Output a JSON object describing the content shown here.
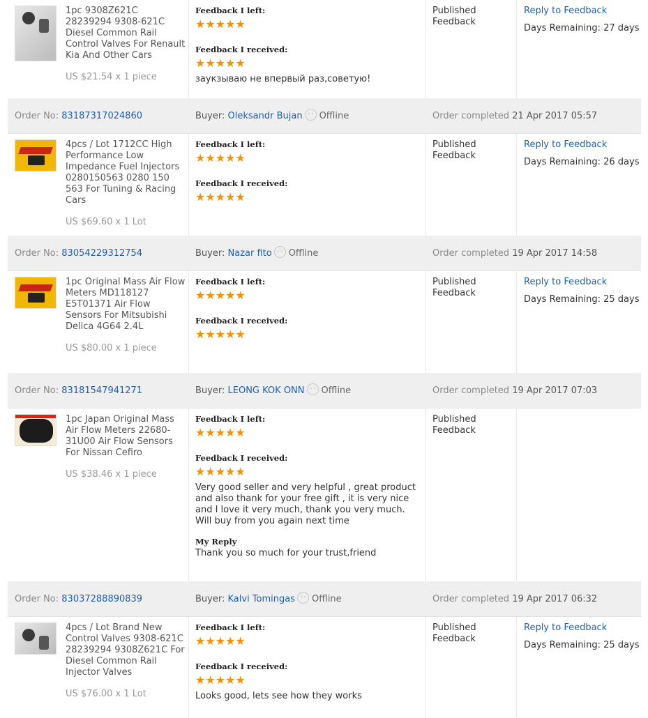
{
  "labels": {
    "order_no": "Order No:",
    "buyer": "Buyer:",
    "offline": "Offline",
    "order_completed": "Order completed",
    "feedback_left": "Feedback I left:",
    "feedback_received": "Feedback I received:",
    "published": "Published Feedback",
    "reply_link": "Reply to Feedback",
    "my_reply": "My Reply"
  },
  "top_row": {
    "product_title": "1pc 9308Z621C 28239294 9308-621C Diesel Common Rail Control Valves For Renault Kia And Other Cars",
    "price": "US $21.54 x 1 piece",
    "stars_left": "★★★★★",
    "stars_received": "★★★★★",
    "comment": "заукзываю не впервый раз,советую!",
    "days_remaining": "Days Remaining: 27 days"
  },
  "orders": [
    {
      "order_no": "83187317024860",
      "buyer": "Oleksandr Bujan",
      "date": "21 Apr 2017 05:57",
      "product_title": "4pcs / Lot 1712CC High Performance Low Impedance Fuel Injectors 0280150563 0280 150 563 For Tuning & Racing Cars",
      "price": "US $69.60 x 1 Lot",
      "stars_left": "★★★★★",
      "stars_received": "★★★★★",
      "days_remaining": "Days Remaining: 26 days"
    },
    {
      "order_no": "83054229312754",
      "buyer": "Nazar fito",
      "date": "19 Apr 2017 14:58",
      "product_title": "1pc Original Mass Air Flow Meters MD118127 E5T01371 Air Flow Sensors For Mitsubishi Delica 4G64 2.4L",
      "price": "US $80.00 x 1 piece",
      "stars_left": "★★★★★",
      "stars_received": "★★★★★",
      "days_remaining": "Days Remaining: 25 days"
    },
    {
      "order_no": "83181547941271",
      "buyer": "LEONG KOK ONN",
      "date": "19 Apr 2017 07:03",
      "product_title": "1pc Japan Original Mass Air Flow Meters 22680-31U00 Air Flow Sensors For Nissan Cefiro",
      "price": "US $38.46 x 1 piece",
      "stars_left": "★★★★★",
      "stars_received": "★★★★★",
      "comment": "Very good seller and very helpful , great product and also thank for your free gift , it is very nice and I love it very much, thank you very much. Will buy from you again next time",
      "reply": "Thank you so much for your trust,friend"
    },
    {
      "order_no": "83037288890839",
      "buyer": "Kalvi Tomingas",
      "date": "19 Apr 2017 06:32",
      "product_title": "4pcs / Lot Brand New Control Valves 9308-621C 28239294 9308Z621C For Diesel Common Rail Injector Valves",
      "price": "US $76.00 x 1 Lot",
      "stars_left": "★★★★★",
      "stars_received": "★★★★★",
      "comment": "Looks good, lets see how they works",
      "days_remaining": "Days Remaining: 25 days"
    }
  ]
}
